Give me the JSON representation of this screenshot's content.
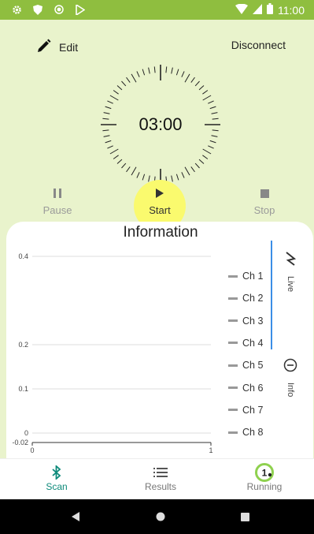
{
  "status_bar": {
    "time": "11:00",
    "icons": [
      "settings-icon",
      "shield-icon",
      "circle-icon",
      "play-store-icon",
      "wifi-icon",
      "signal-icon",
      "battery-icon"
    ]
  },
  "header": {
    "edit_label": "Edit",
    "disconnect_label": "Disconnect"
  },
  "timer": {
    "display": "03:00"
  },
  "controls": {
    "pause_label": "Pause",
    "start_label": "Start",
    "stop_label": "Stop"
  },
  "info_panel": {
    "title": "Information",
    "side_tabs": [
      {
        "label": "Live",
        "icon": "live-signal-icon"
      },
      {
        "label": "Info",
        "icon": "info-icon"
      }
    ]
  },
  "chart_data": {
    "type": "line",
    "title": "",
    "xlabel": "",
    "ylabel": "",
    "x_ticks": [
      "0",
      "1"
    ],
    "y_ticks": [
      "0.4",
      "0.2",
      "0.1",
      "0",
      "-0.02"
    ],
    "xlim": [
      0,
      1
    ],
    "legend": [
      "Ch 1",
      "Ch 2",
      "Ch 3",
      "Ch 4",
      "Ch 5",
      "Ch 6",
      "Ch 7",
      "Ch 8"
    ],
    "legend_placement": "right",
    "grid": true,
    "series": []
  },
  "bottom_nav": {
    "items": [
      {
        "label": "Scan",
        "icon": "bluetooth-icon",
        "active": true
      },
      {
        "label": "Results",
        "icon": "list-icon",
        "active": false
      },
      {
        "label": "Running",
        "icon": "running-counter-icon",
        "badge": "1",
        "active": false
      }
    ]
  },
  "colors": {
    "status_bar": "#8fbe3f",
    "background": "#e9f3cc",
    "highlight": "#fafa6e",
    "active_nav": "#0d8a7a",
    "live_indicator": "#3b8ee6",
    "running_ring": "#8fd14f"
  }
}
